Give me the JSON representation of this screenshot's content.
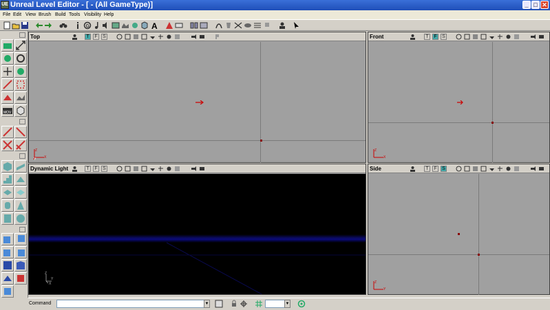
{
  "window": {
    "title": "Unreal Level Editor - [ - (All GameType)]",
    "icon_label": "UE",
    "minimize_glyph": "_",
    "maximize_glyph": "□",
    "close_glyph": "✕"
  },
  "menu": [
    {
      "label": "File"
    },
    {
      "label": "Edit"
    },
    {
      "label": "View"
    },
    {
      "label": "Brush"
    },
    {
      "label": "Build"
    },
    {
      "label": "Tools"
    },
    {
      "label": "Visibility"
    },
    {
      "label": "Help"
    }
  ],
  "toolbar_icons": [
    "new-icon",
    "open-icon",
    "save-icon",
    "undo-icon",
    "redo-icon",
    "search-icon",
    "info-icon",
    "group-icon",
    "music-icon",
    "sound-icon",
    "texture-icon",
    "mesh-icon",
    "anim-icon",
    "static-mesh-icon",
    "font-icon",
    "actor-class-icon",
    "properties-icon",
    "build-geometry-icon",
    "build-lighting-icon",
    "build-paths-icon",
    "build-all-icon",
    "play-icon",
    "pointer-icon"
  ],
  "viewports": {
    "top": {
      "title": "Top",
      "modes": [
        "T",
        "F",
        "S"
      ],
      "active_mode": "T"
    },
    "front": {
      "title": "Front",
      "modes": [
        "T",
        "F",
        "S"
      ],
      "active_mode": "F"
    },
    "perspective": {
      "title": "Dynamic Light",
      "modes": [
        "T",
        "F",
        "S"
      ],
      "active_mode": ""
    },
    "side": {
      "title": "Side",
      "modes": [
        "T",
        "F",
        "S"
      ],
      "active_mode": "S"
    }
  },
  "axis_labels": {
    "z": "Z",
    "x": "X",
    "y": "Y"
  },
  "command": {
    "label": "Command",
    "value": "",
    "grid_value": ""
  },
  "colors": {
    "ortho_bg": "#a0a0a0",
    "persp_bg": "#000000",
    "title_bar": "#2a5cc8",
    "viewport_mode_active": "#44aaaa"
  }
}
